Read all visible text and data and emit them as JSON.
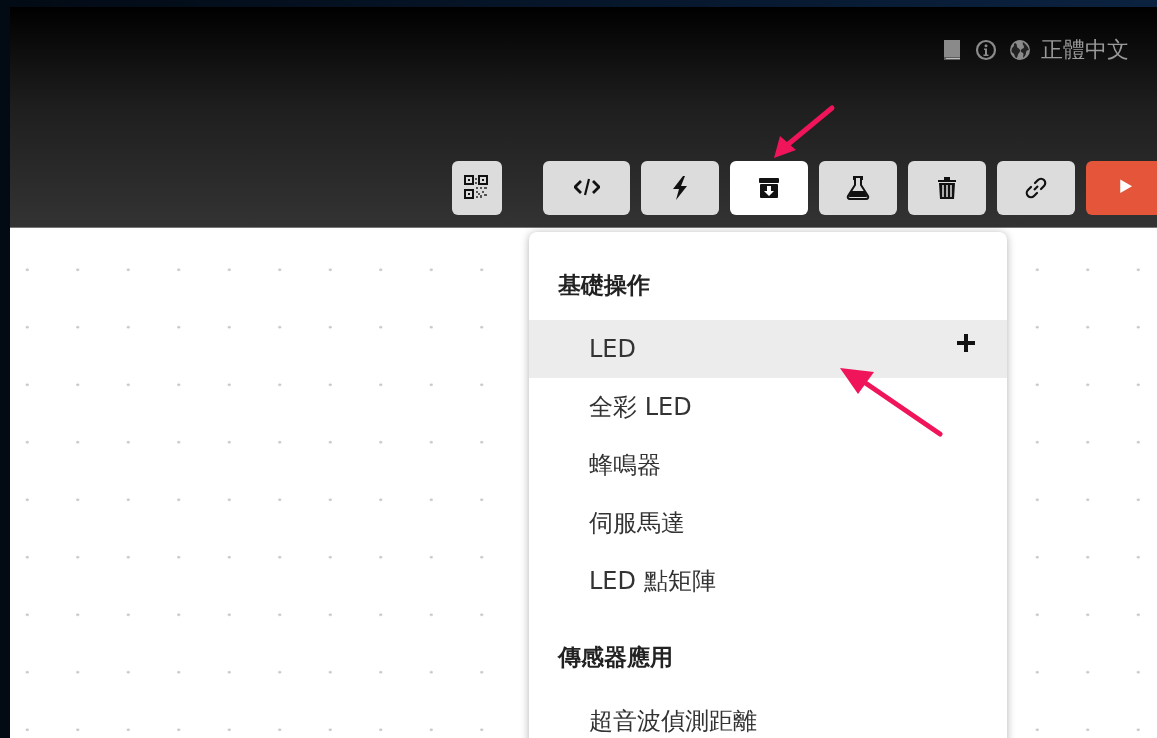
{
  "header_links": [
    {
      "kind": "book"
    },
    {
      "kind": "info"
    },
    {
      "kind": "language",
      "label": "正體中文"
    }
  ],
  "toolbar": [
    {
      "kind": "qr",
      "selected": false
    },
    {
      "kind": "code",
      "selected": false
    },
    {
      "kind": "flash",
      "selected": false
    },
    {
      "kind": "archive",
      "selected": true
    },
    {
      "kind": "flask",
      "selected": false
    },
    {
      "kind": "trash",
      "selected": false
    },
    {
      "kind": "link",
      "selected": false
    },
    {
      "kind": "run",
      "selected": false
    }
  ],
  "menu": {
    "sections": [
      {
        "heading": "基礎操作",
        "items": [
          {
            "label": "LED",
            "selected": true
          },
          {
            "label": "全彩 LED",
            "selected": false
          },
          {
            "label": "蜂鳴器",
            "selected": false
          },
          {
            "label": "伺服馬達",
            "selected": false
          },
          {
            "label": "LED 點矩陣",
            "selected": false
          }
        ]
      },
      {
        "heading": "傳感器應用",
        "items": [
          {
            "label": "超音波偵測距離",
            "selected": false
          }
        ]
      }
    ]
  },
  "annotations": [
    {
      "kind": "arrow-down-left"
    },
    {
      "kind": "arrow-up-left"
    }
  ]
}
